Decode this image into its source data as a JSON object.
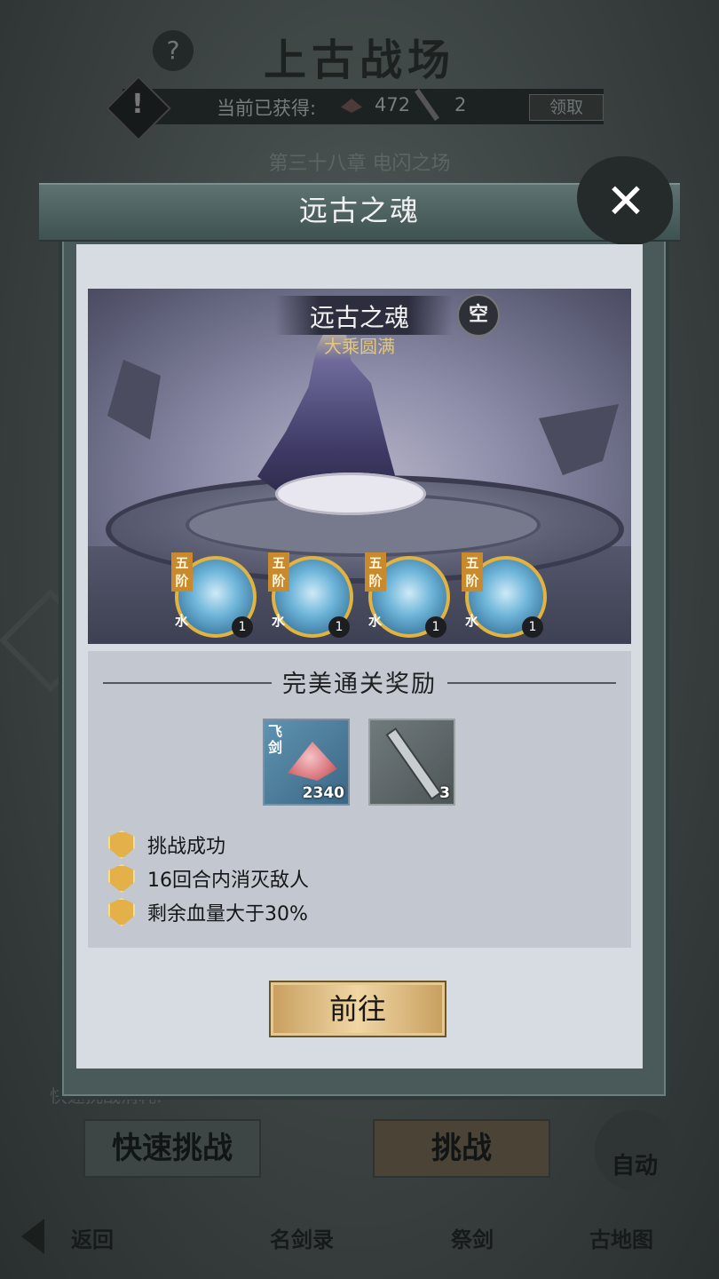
{
  "background": {
    "title": "上古战场",
    "help_icon": "?",
    "resource": {
      "label": "当前已获得:",
      "gem_value": "472",
      "sword_value": "2",
      "claim_label": "领取"
    },
    "chapter": "第三十八章 电闪之场",
    "cost_text": "快速挑战消耗:",
    "quick_challenge_label": "快速挑战",
    "challenge_label": "挑战",
    "auto_label": "自动",
    "nav": {
      "back": "返回",
      "famous_swords": "名剑录",
      "sacrifice_sword": "祭剑",
      "ancient_map": "古地图"
    }
  },
  "modal": {
    "title": "远古之魂",
    "close_icon": "close-icon",
    "boss": {
      "name": "远古之魂",
      "subtitle": "大乘圆满",
      "element_badge": "空"
    },
    "skills": [
      {
        "tier": "五阶",
        "element": "水",
        "level": "1"
      },
      {
        "tier": "五阶",
        "element": "水",
        "level": "1"
      },
      {
        "tier": "五阶",
        "element": "水",
        "level": "1"
      },
      {
        "tier": "五阶",
        "element": "水",
        "level": "1"
      }
    ],
    "reward_section": {
      "title": "完美通关奖励",
      "items": [
        {
          "icon": "crystal-icon",
          "tag": "飞剑",
          "count": "2340"
        },
        {
          "icon": "sword-icon",
          "tag": "",
          "count": "3"
        }
      ],
      "conditions": [
        "挑战成功",
        "16回合内消灭敌人",
        "剩余血量大于30%"
      ]
    },
    "go_button_label": "前往"
  },
  "colors": {
    "accent_gold": "#e2b341",
    "modal_bg": "#d7dce2",
    "header_bg": "#4f6262"
  }
}
